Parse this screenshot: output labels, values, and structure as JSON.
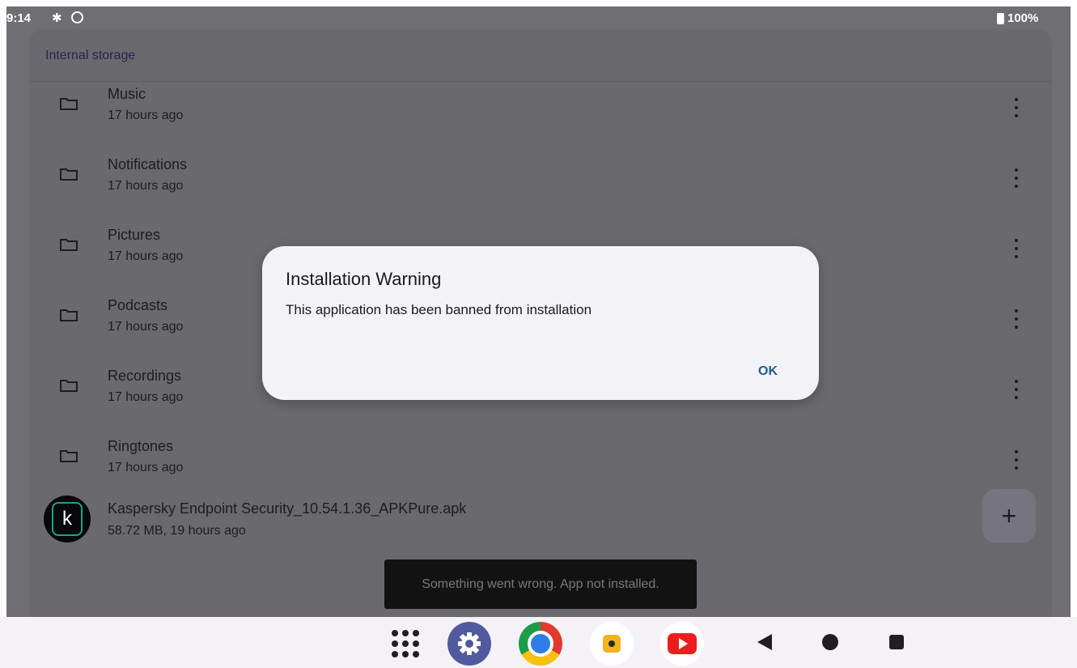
{
  "status_bar": {
    "time": "9:14",
    "battery": "100%"
  },
  "file_list": {
    "location": "Internal storage",
    "folders": [
      {
        "name": "Music",
        "meta": "17 hours ago"
      },
      {
        "name": "Notifications",
        "meta": "17 hours ago"
      },
      {
        "name": "Pictures",
        "meta": "17 hours ago"
      },
      {
        "name": "Podcasts",
        "meta": "17 hours ago"
      },
      {
        "name": "Recordings",
        "meta": "17 hours ago"
      },
      {
        "name": "Ringtones",
        "meta": "17 hours ago"
      }
    ],
    "apk_file": {
      "icon_letter": "k",
      "name": "Kaspersky Endpoint Security_10.54.1.36_APKPure.apk",
      "meta": "58.72 MB, 19 hours ago"
    },
    "fab_label": "+"
  },
  "dialog": {
    "title": "Installation Warning",
    "message": "This application has been banned from installation",
    "ok_label": "OK"
  },
  "toast": {
    "message": "Something went wrong. App not installed."
  },
  "taskbar": {
    "apps": [
      "app-drawer-icon",
      "settings-icon",
      "chrome-icon",
      "recorder-icon",
      "youtube-icon"
    ],
    "nav": [
      "back-icon",
      "home-icon",
      "recents-icon"
    ]
  },
  "colors": {
    "dialog_accent": "#1b5e8c",
    "scrim": "#6f6e72",
    "dialog_bg": "#f3f2f6"
  }
}
